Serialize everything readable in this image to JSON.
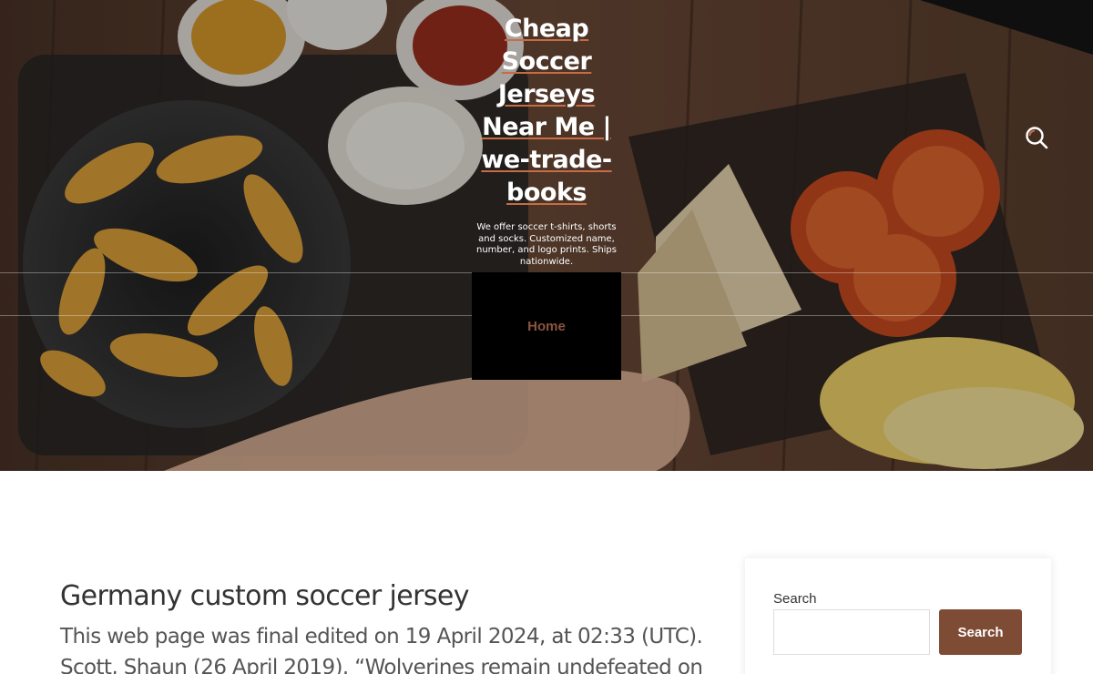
{
  "header": {
    "site_title": "Cheap Soccer Jerseys Near Me | we-trade-books",
    "tagline": "We offer soccer t-shirts, shorts and socks. Customized name, number, and logo prints. Ships nationwide.",
    "search_icon": "search-icon"
  },
  "nav": {
    "items": [
      {
        "label": "Home"
      }
    ]
  },
  "article": {
    "title": "Germany custom soccer jersey",
    "line1": "This web page was final edited on 19 April 2024, at 02:33 (UTC).",
    "line2": "Scott, Shaun (26 April 2019). “Wolverines remain undefeated on"
  },
  "sidebar": {
    "search_label": "Search",
    "search_value": "",
    "search_button": "Search"
  },
  "colors": {
    "accent": "#7e4b35",
    "title_underline": "#c76c44",
    "nav_link": "#8a5540"
  }
}
